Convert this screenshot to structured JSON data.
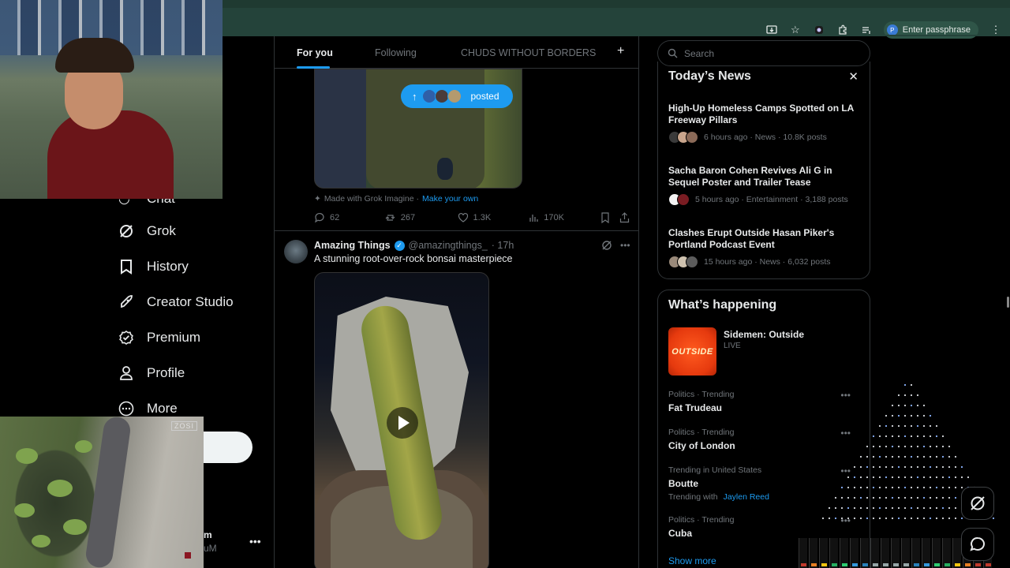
{
  "browser": {
    "profile_label": "Enter passphrase",
    "profile_initial": "P"
  },
  "nav": {
    "items": [
      {
        "label": "Grok",
        "icon": "grok-icon"
      },
      {
        "label": "History",
        "icon": "bookmark-icon"
      },
      {
        "label": "Creator Studio",
        "icon": "rocket-icon"
      },
      {
        "label": "Premium",
        "icon": "premium-badge-icon"
      },
      {
        "label": "Profile",
        "icon": "person-icon"
      },
      {
        "label": "More",
        "icon": "more-circle-icon"
      }
    ],
    "partial_label": "Chat",
    "account_name": "m",
    "account_handle": "uM"
  },
  "pond_cam": {
    "brand": "ZOSI"
  },
  "tabs": [
    {
      "label": "For you",
      "active": true
    },
    {
      "label": "Following",
      "active": false
    },
    {
      "label": "CHUDS WITHOUT BORDERS",
      "active": false
    }
  ],
  "new_posts_pill": {
    "label": "posted"
  },
  "post1": {
    "made_with": "Made with Grok Imagine ·",
    "make_link": "Make your own",
    "replies": "62",
    "reposts": "267",
    "likes": "1.3K",
    "views": "170K"
  },
  "post2": {
    "name": "Amazing Things",
    "handle": "@amazingthings_",
    "time": "· 17h",
    "text": "A stunning root-over-rock bonsai masterpiece"
  },
  "search": {
    "placeholder": "Search"
  },
  "news": {
    "title": "Today’s News",
    "items": [
      {
        "headline": "High-Up Homeless Camps Spotted on LA Freeway Pillars",
        "meta": "6 hours ago · News · 10.8K posts"
      },
      {
        "headline": "Sacha Baron Cohen Revives Ali G in Sequel Poster and Trailer Tease",
        "meta": "5 hours ago · Entertainment · 3,188 posts"
      },
      {
        "headline": "Clashes Erupt Outside Hasan Piker's Portland Podcast Event",
        "meta": "15 hours ago · News · 6,032 posts"
      }
    ]
  },
  "happening": {
    "title": "What’s happening",
    "event": {
      "name": "Sidemen: Outside",
      "status": "LIVE",
      "thumb_text": "OUTSIDE"
    },
    "trends": [
      {
        "context": "Politics · Trending",
        "topic": "Fat Trudeau"
      },
      {
        "context": "Politics · Trending",
        "topic": "City of London"
      },
      {
        "context": "Trending in United States",
        "topic": "Boutte",
        "with_label": "Trending with",
        "with_link": "Jaylen Reed"
      },
      {
        "context": "Politics · Trending",
        "topic": "Cuba"
      }
    ],
    "show_more": "Show more"
  },
  "colors": {
    "accent": "#1d9bf0",
    "chrome": "#24433a",
    "text": "#e7e9ea",
    "muted": "#71767b"
  }
}
